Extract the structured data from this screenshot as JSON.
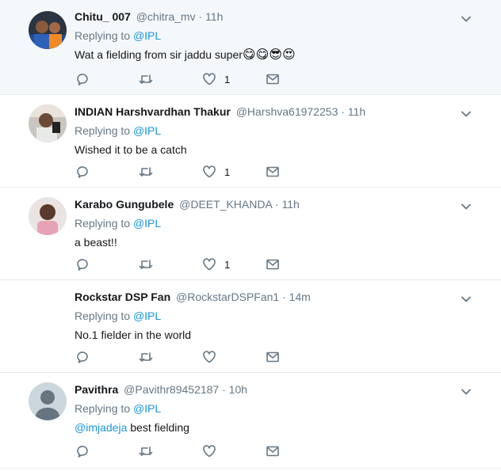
{
  "colors": {
    "accent": "#1b95e0",
    "muted": "#657786",
    "border": "#e6ecf0",
    "highlight_bg": "#f5f8fa"
  },
  "tweets": [
    {
      "name": "Chitu_ 007",
      "handle": "@chitra_mv",
      "time": "· 11h",
      "replying_prefix": "Replying to",
      "replying_to": "@IPL",
      "text": "Wat a fielding from sir jaddu super",
      "emojis": "😋😋😎😍",
      "like_count": "1",
      "avatar": "cricketer-photo"
    },
    {
      "name": "INDIAN Harshvardhan Thakur",
      "handle": "@Harshva61972253",
      "time": "· 11h",
      "replying_prefix": "Replying to",
      "replying_to": "@IPL",
      "text": "Wished it to be a catch",
      "like_count": "1",
      "avatar": "selfie-photo"
    },
    {
      "name": "Karabo Gungubele",
      "handle": "@DEET_KHANDA",
      "time": "· 11h",
      "replying_prefix": "Replying to",
      "replying_to": "@IPL",
      "text": "a beast!!",
      "like_count": "1",
      "avatar": "portrait-photo"
    },
    {
      "name": "Rockstar DSP Fan",
      "handle": "@RockstarDSPFan1",
      "time": "· 14m",
      "replying_prefix": "Replying to",
      "replying_to": "@IPL",
      "text": "No.1 fielder in the world",
      "like_count": "",
      "avatar": "none"
    },
    {
      "name": "Pavithra",
      "handle": "@Pavithr89452187",
      "time": "· 10h",
      "replying_prefix": "Replying to",
      "replying_to": "@IPL",
      "text_mention": "@imjadeja",
      "text": " best fielding",
      "like_count": "",
      "avatar": "default-avatar"
    }
  ]
}
